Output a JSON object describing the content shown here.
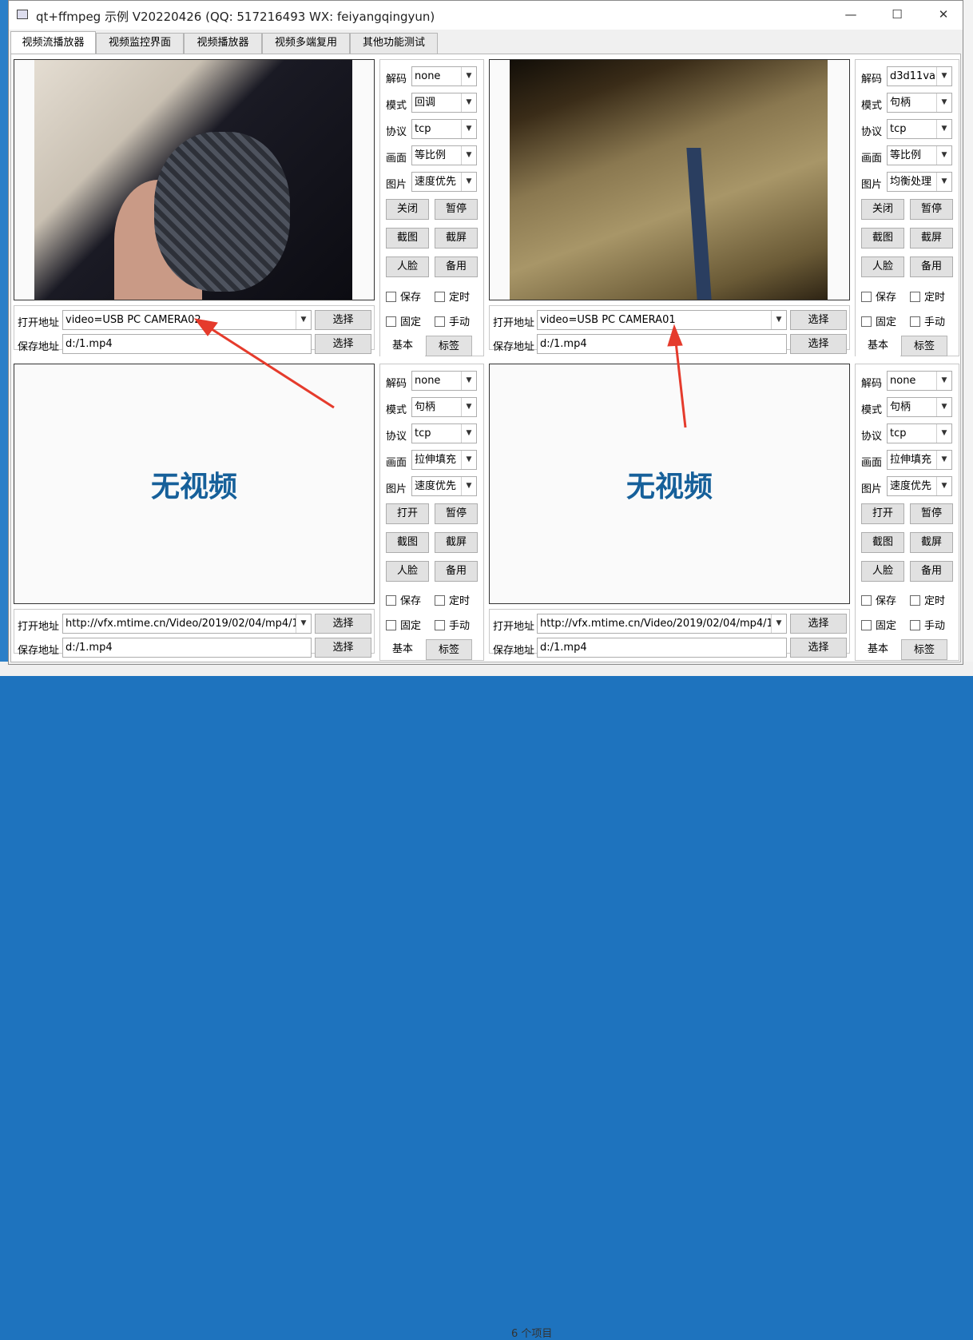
{
  "window": {
    "title": "qt+ffmpeg 示例 V20220426 (QQ: 517216493 WX: feiyangqingyun)",
    "minimize": "—",
    "maximize": "☐",
    "close": "✕"
  },
  "tabs": [
    "视频流播放器",
    "视频监控界面",
    "视频播放器",
    "视频多端复用",
    "其他功能测试"
  ],
  "labels": {
    "decode": "解码",
    "mode": "模式",
    "protocol": "协议",
    "picture": "画面",
    "image": "图片",
    "open_addr": "打开地址",
    "save_addr": "保存地址",
    "select": "选择",
    "save": "保存",
    "timer": "定时",
    "fixed": "固定",
    "manual": "手动",
    "pause": "暂停",
    "screenshot": "截图",
    "screencap": "截屏",
    "face": "人脸",
    "backup": "备用",
    "basic": "基本",
    "tag": "标签",
    "no_video": "无视频"
  },
  "panels": [
    {
      "decode": "none",
      "mode": "回调",
      "protocol": "tcp",
      "picture": "等比例",
      "image": "速度优先",
      "toggle_btn": "关闭",
      "open_url": "video=USB PC CAMERA02",
      "save_path": "d:/1.mp4"
    },
    {
      "decode": "d3d11va",
      "mode": "句柄",
      "protocol": "tcp",
      "picture": "等比例",
      "image": "均衡处理",
      "toggle_btn": "关闭",
      "open_url": "video=USB PC CAMERA01",
      "save_path": "d:/1.mp4"
    },
    {
      "decode": "none",
      "mode": "句柄",
      "protocol": "tcp",
      "picture": "拉伸填充",
      "image": "速度优先",
      "toggle_btn": "打开",
      "open_url": "http://vfx.mtime.cn/Video/2019/02/04/mp4/1",
      "save_path": "d:/1.mp4"
    },
    {
      "decode": "none",
      "mode": "句柄",
      "protocol": "tcp",
      "picture": "拉伸填充",
      "image": "速度优先",
      "toggle_btn": "打开",
      "open_url": "http://vfx.mtime.cn/Video/2019/02/04/mp4/1",
      "save_path": "d:/1.mp4"
    }
  ],
  "background": {
    "status_text": "6 个项目"
  },
  "colors": {
    "accent": "#16609a",
    "annotation_arrow": "#e53b2c"
  }
}
